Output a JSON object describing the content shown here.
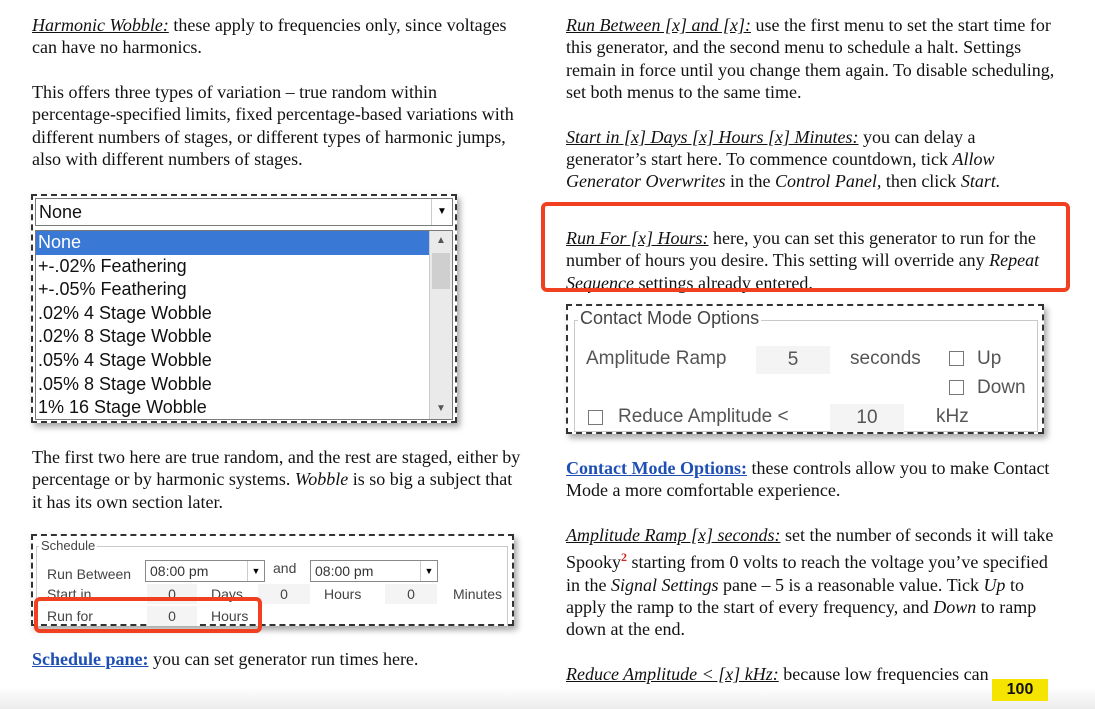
{
  "left": {
    "p1_term": "Harmonic Wobble:",
    "p1_text": " these apply to frequencies only, since voltages can have no harmonics.",
    "p2_text": "This offers three types of variation – true random within percentage-specified limits, fixed percentage-based variations with different numbers of stages, or different types of harmonic jumps, also with different numbers of stages.",
    "p3_a": "The first two here are true random, and the rest are staged, either by percentage or by harmonic systems. ",
    "p3_em": "Wobble",
    "p3_b": " is so big a subject that it has its own section later.",
    "p4_link": "Schedule pane:",
    "p4_text": " you can set generator run times here."
  },
  "dropdown": {
    "selected": "None",
    "options": [
      "None",
      "+-.02% Feathering",
      "+-.05% Feathering",
      ".02% 4 Stage Wobble",
      ".02% 8 Stage Wobble",
      ".05% 4 Stage Wobble",
      ".05% 8 Stage Wobble",
      "1% 16 Stage Wobble"
    ],
    "highlighted": "None"
  },
  "schedule": {
    "legend": "Schedule",
    "run_between_label": "Run Between",
    "time1": "08:00 pm",
    "and_label": "and",
    "time2": "08:00 pm",
    "start_in_label": "Start in",
    "days_value": "0",
    "days_label": "Days",
    "hours_value": "0",
    "hours_label": "Hours",
    "minutes_value": "0",
    "minutes_label": "Minutes",
    "run_for_label": "Run for",
    "run_for_value": "0",
    "run_for_unit": "Hours"
  },
  "right": {
    "r1_term": "Run Between [x] and [x]:",
    "r1_text": " use the first menu to set the start time for this generator, and the second menu to schedule a halt. Settings remain in force until you change them again. To disable scheduling, set both menus to the same time.",
    "r2_term": "Start in [x] Days [x] Hours [x] Minutes:",
    "r2_text_a": " you can delay a generator’s start here. To commence countdown, tick ",
    "r2_em1": "Allow Generator Overwrites",
    "r2_text_b": " in the ",
    "r2_em2": "Control Panel,",
    "r2_text_c": " then click ",
    "r2_em3": "Start.",
    "r3_term": "Run For [x] Hours:",
    "r3_text_a": " here, you can set this generator to run for the number of hours you desire. This setting will override any ",
    "r3_em": "Repeat Sequence",
    "r3_text_b": " settings already entered.",
    "r4_link": "Contact Mode Options:",
    "r4_text": " these controls allow you to make Contact Mode a more comfortable experience.",
    "r5_term": "Amplitude Ramp [x] seconds:",
    "r5_text_a": " set the number of seconds it will take Spooky",
    "r5_sup": "2",
    "r5_text_b": " starting from 0 volts to reach the voltage you’ve specified in the ",
    "r5_em1": "Signal Settings",
    "r5_text_c": " pane – 5 is a reasonable value. Tick ",
    "r5_em2": "Up",
    "r5_text_d": " to apply the ramp to the start of every frequency, and ",
    "r5_em3": "Down",
    "r5_text_e": " to ramp down at the end.",
    "r6_term": "Reduce Amplitude < [x] kHz:",
    "r6_text": " because low frequencies can"
  },
  "contact_mode": {
    "legend": "Contact Mode Options",
    "amp_ramp_label": "Amplitude Ramp",
    "amp_ramp_value": "5",
    "seconds_label": "seconds",
    "up_label": "Up",
    "down_label": "Down",
    "reduce_label": "Reduce Amplitude <",
    "reduce_value": "10",
    "khz_label": "kHz"
  },
  "page_number": "100",
  "colors": {
    "highlight_red": "#f0401f",
    "link_blue": "#1e4fb4",
    "page_badge": "#f5e400",
    "selection": "#3a78d6"
  }
}
